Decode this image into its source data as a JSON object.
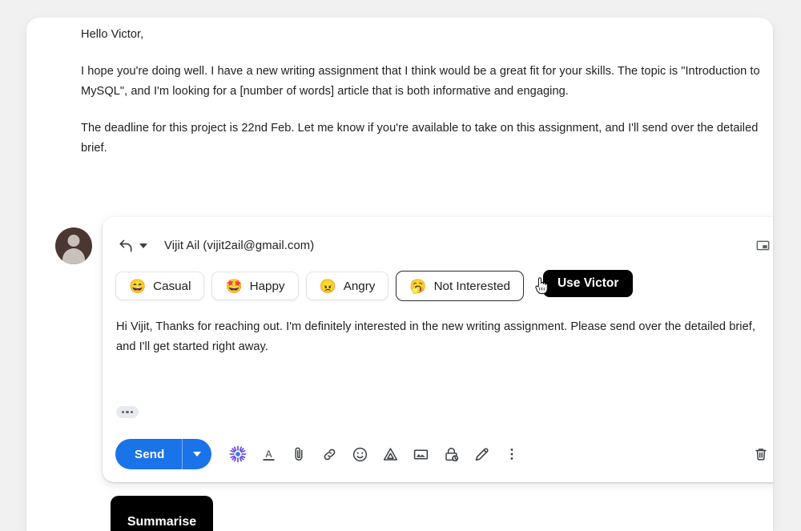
{
  "message": {
    "paragraphs": [
      "Hello Victor,",
      "I hope you're doing well. I have a new writing assignment that I think would be a great fit for your skills. The topic is \"Introduction to MySQL\", and I'm looking for a [number of words] article that is both informative and engaging.",
      "The deadline for this project is 22nd Feb. Let me know if you're available to take on this assignment, and I'll send over the detailed brief."
    ]
  },
  "compose": {
    "reply_icon": "reply-arrow-icon",
    "recipient_caret_icon": "chevron-down-icon",
    "recipient": "Vijit Ail (vijit2ail@gmail.com)",
    "popout_icon": "popout-window-icon",
    "tones": [
      {
        "emoji": "😄",
        "emoji_name": "grinning-face-icon",
        "label": "Casual",
        "selected": false
      },
      {
        "emoji": "🤩",
        "emoji_name": "star-struck-face-icon",
        "label": "Happy",
        "selected": false
      },
      {
        "emoji": "😠",
        "emoji_name": "angry-face-icon",
        "label": "Angry",
        "selected": false
      },
      {
        "emoji": "🥱",
        "emoji_name": "yawning-face-icon",
        "label": "Not Interested",
        "selected": true
      }
    ],
    "use_victor_label": "Use Victor",
    "body": "Hi Vijit, Thanks for reaching out. I'm definitely interested in the new writing assignment. Please send over the detailed brief, and I'll get started right away.",
    "trimmed_content_icon": "ellipsis-icon",
    "toolbar": {
      "send_label": "Send",
      "send_dropdown_icon": "chevron-down-icon",
      "icons": [
        "ai-sparkle-icon",
        "text-format-icon",
        "attach-file-icon",
        "insert-link-icon",
        "insert-emoji-icon",
        "insert-drive-icon",
        "insert-photo-icon",
        "confidential-mode-icon",
        "insert-signature-icon",
        "more-options-icon"
      ],
      "discard_icon": "trash-icon"
    }
  },
  "summarise": {
    "label": "Summarise"
  },
  "cursor": {
    "icon": "pointing-hand-cursor"
  },
  "colors": {
    "send_blue": "#1a73e8",
    "accent_black": "#000000",
    "page_bg": "#f1f1f1",
    "card_bg": "#ffffff",
    "text": "#202124"
  }
}
